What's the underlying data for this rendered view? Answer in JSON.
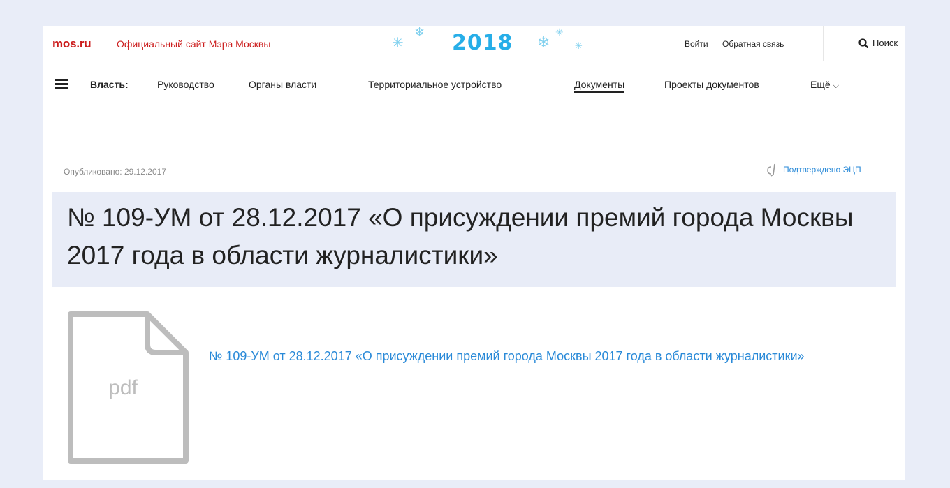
{
  "header": {
    "logo": "mos.ru",
    "site_title": "Официальный сайт Мэра Москвы",
    "holiday_year": "2018",
    "login_label": "Войти",
    "feedback_label": "Обратная связь",
    "search_label": "Поиск",
    "search_icon": "search-icon"
  },
  "nav": {
    "menu_icon": "menu-icon",
    "heading": "Власть:",
    "items": [
      {
        "label": "Руководство"
      },
      {
        "label": "Органы власти"
      },
      {
        "label": "Территориальное устройство"
      },
      {
        "label": "Документы",
        "active": true
      },
      {
        "label": "Проекты документов"
      },
      {
        "label": "Ещё"
      }
    ],
    "more_icon": "chevron-down-icon"
  },
  "document": {
    "published": "Опубликовано: 29.12.2017",
    "ecp_label": "Подтверждено ЭЦП",
    "ecp_icon": "signature-icon",
    "title": "№ 109-УМ от 28.12.2017 «О присуждении премий города Москвы 2017 года в области журналистики»",
    "file_type": "pdf",
    "file_icon": "pdf-file-icon",
    "file_link": "№ 109-УМ от 28.12.2017 «О присуждении премий города Москвы 2017 года в области журналистики»"
  },
  "colors": {
    "brand_red": "#cc1e1e",
    "link_blue": "#2a8ad8",
    "holiday_blue": "#27aee8",
    "title_bg": "#e8ecf7",
    "page_bg": "#e9edf8"
  }
}
